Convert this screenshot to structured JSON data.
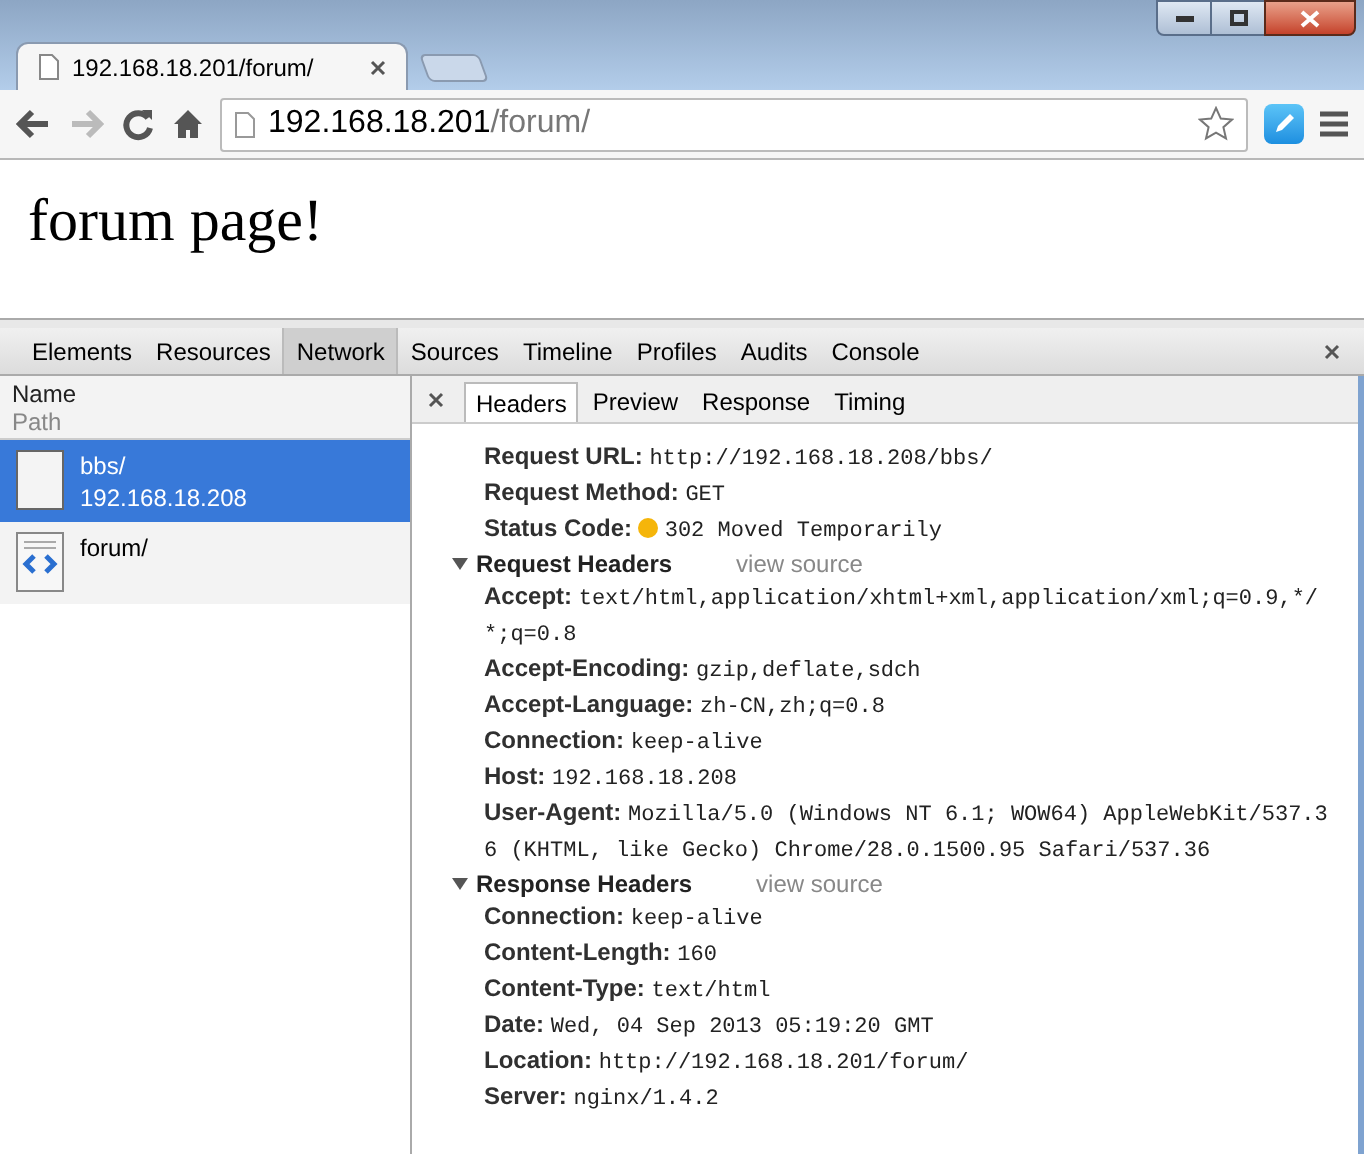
{
  "tabs": [
    {
      "title": "192.168.18.201/forum/",
      "selected": true
    }
  ],
  "address": {
    "host": "192.168.18.201",
    "path": "/forum/"
  },
  "page": {
    "text": "forum page!"
  },
  "devtools_tabs": [
    {
      "label": "Elements",
      "selected": false
    },
    {
      "label": "Resources",
      "selected": false
    },
    {
      "label": "Network",
      "selected": true
    },
    {
      "label": "Sources",
      "selected": false
    },
    {
      "label": "Timeline",
      "selected": false
    },
    {
      "label": "Profiles",
      "selected": false
    },
    {
      "label": "Audits",
      "selected": false
    },
    {
      "label": "Console",
      "selected": false
    }
  ],
  "columns": {
    "name": "Name",
    "path": "Path"
  },
  "requests": [
    {
      "name": "bbs/",
      "path": "192.168.18.208",
      "kind": "blank",
      "selected": true
    },
    {
      "name": "forum/",
      "kind": "html",
      "selected": false
    }
  ],
  "detail_tabs": [
    {
      "label": "Headers",
      "selected": true
    },
    {
      "label": "Preview",
      "selected": false
    },
    {
      "label": "Response",
      "selected": false
    },
    {
      "label": "Timing",
      "selected": false
    }
  ],
  "general": [
    {
      "label": "Request URL:",
      "value": "http://192.168.18.208/bbs/"
    },
    {
      "label": "Request Method:",
      "value": "GET"
    },
    {
      "label": "Status Code:",
      "value": "302 Moved Temporarily",
      "kind": "status"
    }
  ],
  "sections": [
    {
      "title": "Request Headers",
      "link": "view source",
      "expanded": true,
      "headers": [
        {
          "label": "Accept:",
          "value": "text/html,application/xhtml+xml,application/xml;q=0.9,*/*;q=0.8"
        },
        {
          "label": "Accept-Encoding:",
          "value": "gzip,deflate,sdch"
        },
        {
          "label": "Accept-Language:",
          "value": "zh-CN,zh;q=0.8"
        },
        {
          "label": "Connection:",
          "value": "keep-alive"
        },
        {
          "label": "Host:",
          "value": "192.168.18.208"
        },
        {
          "label": "User-Agent:",
          "value": "Mozilla/5.0 (Windows NT 6.1; WOW64) AppleWebKit/537.36 (KHTML, like Gecko) Chrome/28.0.1500.95 Safari/537.36"
        }
      ]
    },
    {
      "title": "Response Headers",
      "link": "view source",
      "expanded": true,
      "headers": [
        {
          "label": "Connection:",
          "value": "keep-alive"
        },
        {
          "label": "Content-Length:",
          "value": "160"
        },
        {
          "label": "Content-Type:",
          "value": "text/html"
        },
        {
          "label": "Date:",
          "value": "Wed, 04 Sep 2013 05:19:20 GMT"
        },
        {
          "label": "Location:",
          "value": "http://192.168.18.201/forum/"
        },
        {
          "label": "Server:",
          "value": "nginx/1.4.2"
        }
      ]
    }
  ]
}
